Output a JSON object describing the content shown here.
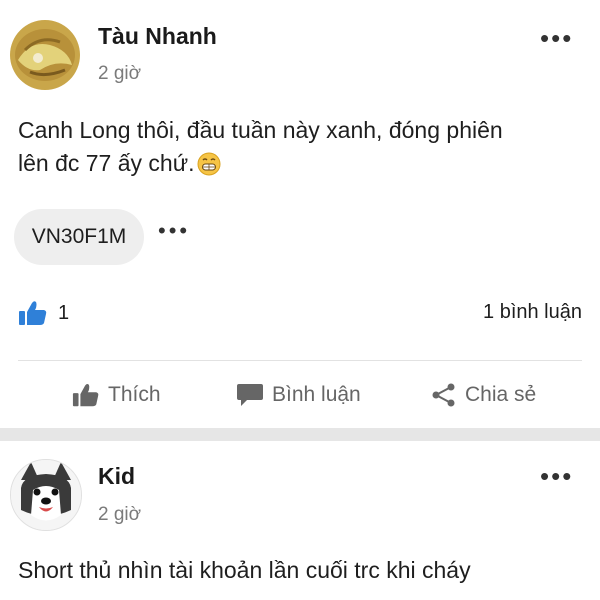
{
  "posts": [
    {
      "author": "Tàu Nhanh",
      "time": "2 giờ",
      "more_glyph": "•••",
      "content_line1": "Canh Long thôi, đầu tuần này xanh, đóng phiên",
      "content_line2": "lên đc 77 ấy chứ.",
      "tag": "VN30F1M",
      "tag_more_glyph": "•••",
      "like_count": "1",
      "comment_count": "1 bình luận",
      "actions": {
        "like": "Thích",
        "comment": "Bình luận",
        "share": "Chia sẻ"
      },
      "accent_color": "#2f80d8"
    },
    {
      "author": "Kid",
      "time": "2 giờ",
      "more_glyph": "•••",
      "content_line1": "Short thủ nhìn tài khoản lần cuối trc khi cháy"
    }
  ]
}
